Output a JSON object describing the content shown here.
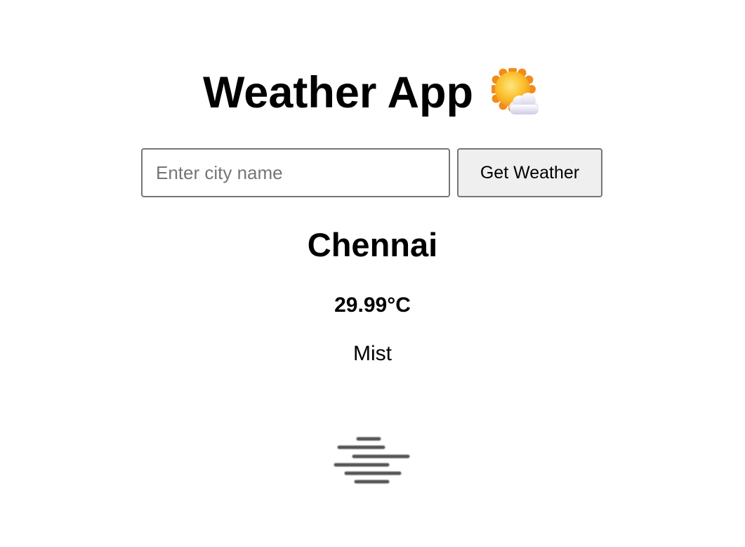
{
  "header": {
    "title": "Weather App",
    "title_icon": "sun-behind-cloud-icon"
  },
  "search": {
    "placeholder": "Enter city name",
    "value": "",
    "button_label": "Get Weather"
  },
  "result": {
    "city": "Chennai",
    "temperature": "29.99°C",
    "description": "Mist",
    "icon": "mist-icon"
  },
  "colors": {
    "background": "#ffffff",
    "text": "#000000",
    "input_border": "#767676",
    "button_background": "#efefef",
    "placeholder": "#757575",
    "sun": "#f5a623",
    "mist_lines": "#555555"
  }
}
